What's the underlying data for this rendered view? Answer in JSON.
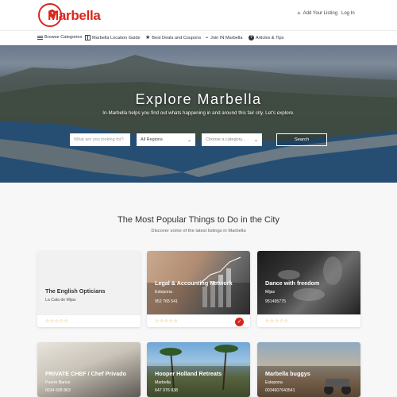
{
  "header": {
    "logo_text": "Marbella",
    "add_listing": "Add Your Listing",
    "login": "Log In"
  },
  "nav": [
    {
      "label": "Browse Categories",
      "icon": "list-icon"
    },
    {
      "label": "Marbella Location Guide",
      "icon": "map-icon"
    },
    {
      "label": "Best Deals and Coupons",
      "icon": "star-icon"
    },
    {
      "label": "Join IN Marbella",
      "icon": "chevron-icon"
    },
    {
      "label": "Articles & Tips",
      "icon": "question-icon"
    }
  ],
  "hero": {
    "title": "Explore Marbella",
    "subtitle": "In-Marbella helps you find out whats happening in and around this fair city. Let's explore.",
    "search_placeholder": "What are you looking for?",
    "region_value": "All Regions",
    "category_value": "Choose a category...",
    "search_button": "Search"
  },
  "section": {
    "title": "The Most Popular Things to Do in the City",
    "subtitle": "Discover some of the latest listings in Marbella"
  },
  "cards": [
    {
      "title": "The English Opticians",
      "location": "La Cala de Mijas",
      "phone": "",
      "verified": false
    },
    {
      "title": "Legal & Accounting Network",
      "location": "Estepona",
      "phone": "952 765 541",
      "verified": true
    },
    {
      "title": "Dance with freedom",
      "location": "Mijas",
      "phone": "951495775",
      "verified": false
    },
    {
      "title": "PRIVATE CHEF / Chef Privado",
      "location": "Puerto Banus",
      "phone": "0034 608 863",
      "verified": false
    },
    {
      "title": "Hooper Holland Retreats",
      "location": "Marbella",
      "phone": "647 076 838",
      "verified": false
    },
    {
      "title": "Marbella buggys",
      "location": "Estepona",
      "phone": "0034607643541",
      "verified": false
    }
  ],
  "rating_stars": "☆☆☆☆☆",
  "colors": {
    "brand_red": "#d9261c",
    "star": "#e2a23b"
  }
}
